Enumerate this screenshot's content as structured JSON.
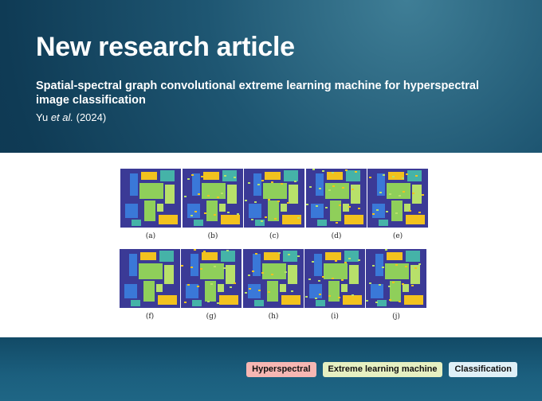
{
  "title": "New research article",
  "subtitle": "Spatial-spectral graph convolutional extreme learning machine for hyperspectral image classification",
  "authors": {
    "name": "Yu",
    "etal": "et al.",
    "year": "(2024)"
  },
  "figure": {
    "captions": [
      "(a)",
      "(b)",
      "(c)",
      "(d)",
      "(e)",
      "(f)",
      "(g)",
      "(h)",
      "(i)",
      "(j)"
    ],
    "colors": {
      "background": "#3b3a96",
      "green": "#8fcf5a",
      "blue": "#3a78d8",
      "yellow": "#f2c21e",
      "teal": "#45b3a8",
      "light": "#b8e06a"
    }
  },
  "tags": [
    "Hyperspectral",
    "Extreme learning machine",
    "Classification"
  ]
}
